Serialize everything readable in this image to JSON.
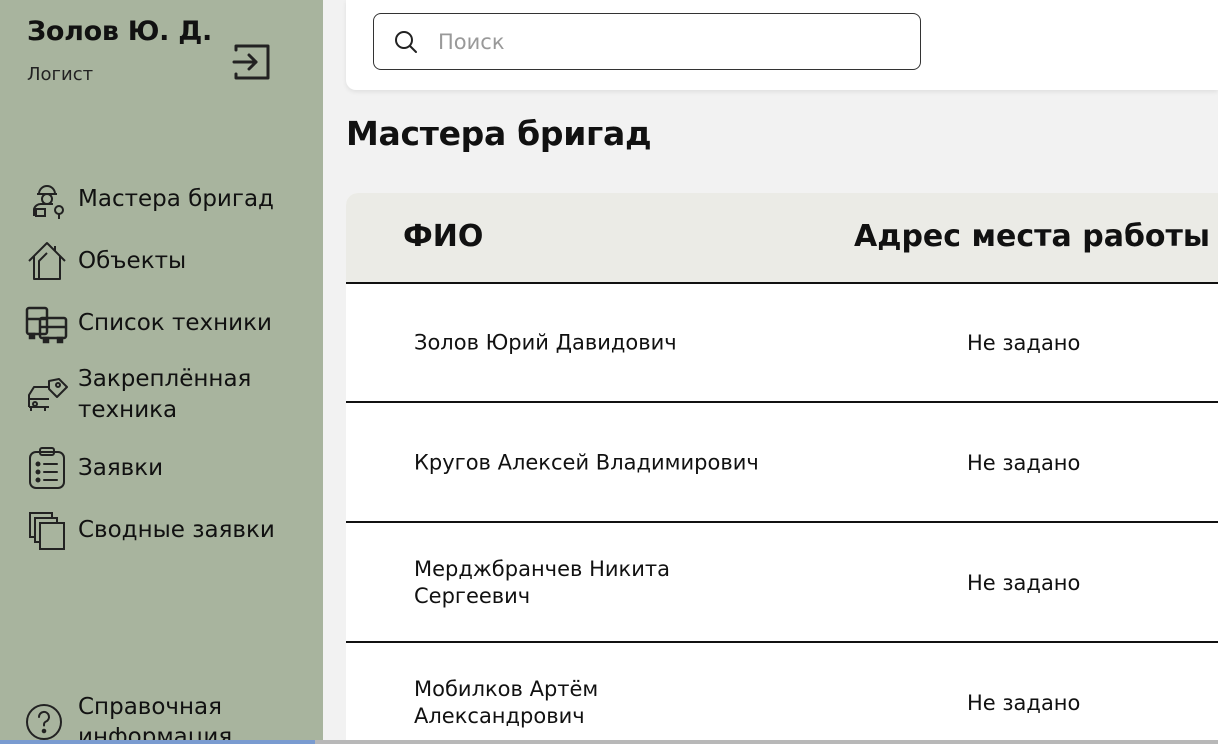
{
  "user": {
    "name": "Золов Ю. Д.",
    "role": "Логист"
  },
  "sidebar": {
    "items": [
      {
        "label": "Мастера бригад",
        "icon": "worker-icon"
      },
      {
        "label": "Объекты",
        "icon": "house-icon"
      },
      {
        "label": "Список техники",
        "icon": "vehicles-icon"
      },
      {
        "label": "Закреплённая техника",
        "icon": "tagged-vehicle-icon"
      },
      {
        "label": "Заявки",
        "icon": "clipboard-icon"
      },
      {
        "label": "Сводные заявки",
        "icon": "stacked-documents-icon"
      }
    ],
    "help_label": "Справочная информация"
  },
  "search": {
    "placeholder": "Поиск",
    "value": ""
  },
  "page_title": "Мастера бригад",
  "table": {
    "columns": [
      "ФИО",
      "Адрес места работы"
    ],
    "rows": [
      {
        "name": "Золов Юрий Давидович",
        "address": "Не задано"
      },
      {
        "name": "Кругов Алексей Владимирович",
        "address": "Не задано"
      },
      {
        "name": "Мерджбранчев Никита Сергеевич",
        "address": "Не задано"
      },
      {
        "name": "Мобилков Артём Александрович",
        "address": "Не задано"
      }
    ]
  },
  "colors": {
    "sidebar_bg": "#a8b49e",
    "header_bg": "#ebebe6",
    "page_bg": "#f2f2f2"
  }
}
